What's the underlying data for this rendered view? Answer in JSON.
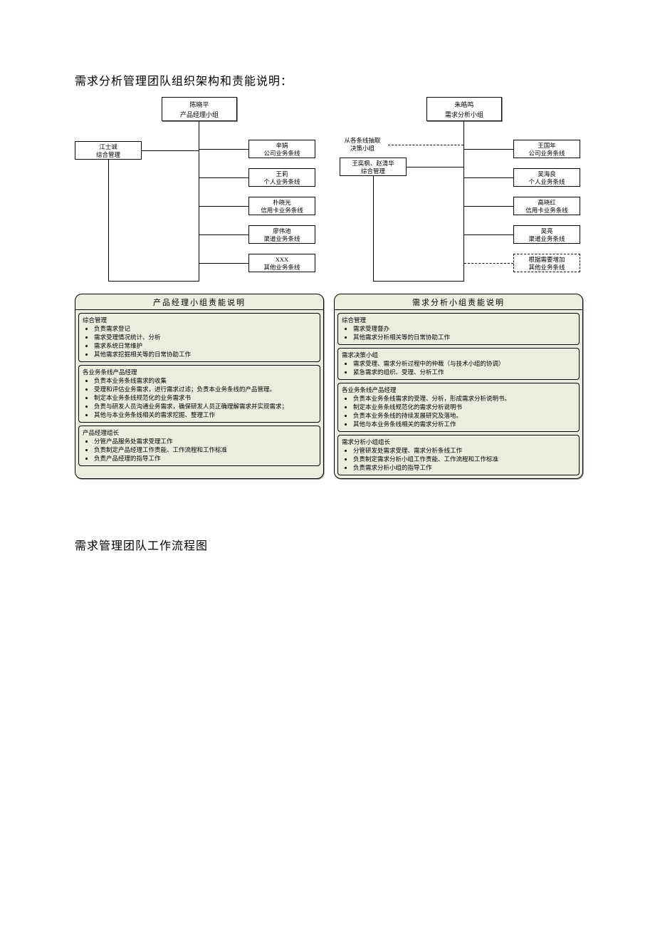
{
  "titles": {
    "main": "需求分析管理团队组织架构和责能说明：",
    "second": "需求管理团队工作流程图"
  },
  "left": {
    "head": {
      "name": "陈晓平",
      "role": "产品经理小组"
    },
    "leftBox": {
      "name": "江士诚",
      "role": "综合管理"
    },
    "right": [
      {
        "name": "辛娟",
        "role": "公司业务条线"
      },
      {
        "name": "王莉",
        "role": "个人业务条线"
      },
      {
        "name": "朴晓光",
        "role": "信用卡业务条线"
      },
      {
        "name": "廖伟池",
        "role": "渠道业务条线"
      },
      {
        "name": "XXX",
        "role": "其他业务条线"
      }
    ]
  },
  "right": {
    "head": {
      "name": "朱皓鸣",
      "role": "需求分析小组"
    },
    "leftNote": "从各条线抽取\n决策小组",
    "leftBoxes": [
      {
        "name": "王奕枫、赵清华",
        "role": "综合管理"
      }
    ],
    "right": [
      {
        "name": "王国年",
        "role": "公司业务条线"
      },
      {
        "name": "吴海良",
        "role": "个人业务条线"
      },
      {
        "name": "高晓红",
        "role": "信用卡业务条线"
      },
      {
        "name": "吴亮",
        "role": "渠道业务条线"
      },
      {
        "name": "根据需要增加",
        "role": "其他业务条线",
        "dashed": true
      }
    ]
  },
  "respLeft": {
    "title": "产品经理小组责能说明",
    "sections": [
      {
        "head": "综合管理",
        "items": [
          "负责需求登记",
          "需求受理情况统计、分析",
          "需求系统日常维护",
          "其他需求挖掘相关等的日常协助工作"
        ]
      },
      {
        "head": "各业务条线产品经理",
        "items": [
          "负责本业务条线需求的收集",
          "受理和评估业务需求，进行需求过滤；负责本业务条线的产品管理。",
          "制定本业务条线规范化的业务需求书",
          "负责与研发人员沟通业务需求，确保研发人员正确理解需求并实现需求；",
          "其他与本业务条线相关的需求挖掘、整理工作"
        ]
      },
      {
        "head": "产品经理组长",
        "items": [
          "分管产品服务处需求受理工作",
          "负责制定产品经理工作责能、工作流程和工作标准",
          "负责产品经理的指导工作"
        ]
      }
    ]
  },
  "respRight": {
    "title": "需求分析小组责能说明",
    "sections": [
      {
        "head": "综合管理",
        "items": [
          "需求受理督办",
          "其他需求分析相关等的日常协助工作"
        ]
      },
      {
        "head": "需求决策小组",
        "items": [
          "需求受理、需求分析过程中的仲裁（与技术小组的协调）",
          "紧急需求的组织、受理、分析工作"
        ]
      },
      {
        "head": "各业务条线产品经理",
        "items": [
          "负责本业务条线需求的受理、分析，形成需求分析说明书。",
          "制定本业务条线规范化的需求分析说明书",
          "负责本业务条线的持续发展研究及落地。",
          "其他与本业务条线相关的需求分析工作"
        ]
      },
      {
        "head": "需求分析小组组长",
        "items": [
          "分管研发处需求受理、需求分析条线工作",
          "负责制定需求分析小组工作责能、工作流程和工作标准",
          "负责需求分析小组的指导工作"
        ]
      }
    ]
  }
}
